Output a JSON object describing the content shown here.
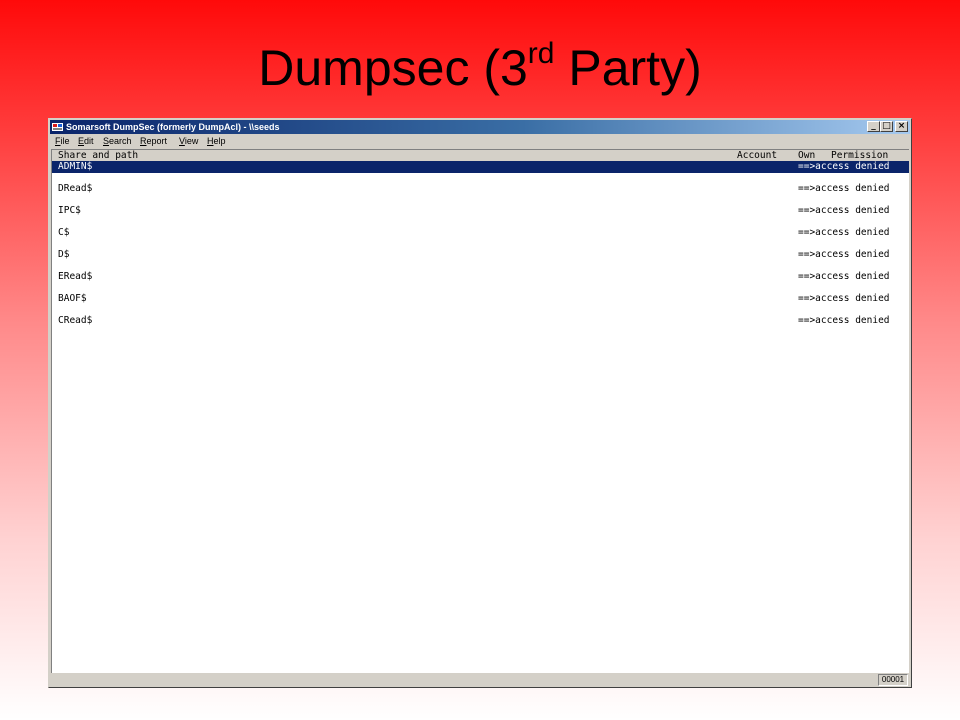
{
  "slide": {
    "title_main": "Dumpsec (3",
    "title_sup": "rd",
    "title_end": " Party)"
  },
  "window": {
    "title": "Somarsoft DumpSec (formerly DumpAcl) - \\\\seeds",
    "buttons": {
      "minimize": "_",
      "maximize": "□",
      "close": "×"
    }
  },
  "menu": {
    "items": [
      {
        "label": "File",
        "accel": "F",
        "rest": "ile"
      },
      {
        "label": "Edit",
        "accel": "E",
        "rest": "dit"
      },
      {
        "label": "Search",
        "accel": "S",
        "rest": "earch"
      },
      {
        "label": "Report",
        "accel": "R",
        "rest": "eport"
      },
      {
        "label": "View",
        "accel": "V",
        "rest": "iew"
      },
      {
        "label": "Help",
        "accel": "H",
        "rest": "elp"
      }
    ]
  },
  "columns": {
    "share_and_path": "Share and path",
    "account": "Account",
    "own": "Own",
    "permission": "Permission"
  },
  "rows": [
    {
      "share": "ADMIN$",
      "permission": "==>access denied",
      "selected": true
    },
    {
      "share": "DRead$",
      "permission": "==>access denied"
    },
    {
      "share": "IPC$",
      "permission": "==>access denied"
    },
    {
      "share": "C$",
      "permission": "==>access denied"
    },
    {
      "share": "D$",
      "permission": "==>access denied"
    },
    {
      "share": "ERead$",
      "permission": "==>access denied"
    },
    {
      "share": "BAOF$",
      "permission": "==>access denied"
    },
    {
      "share": "CRead$",
      "permission": "==>access denied"
    }
  ],
  "status": {
    "count": "00001"
  },
  "colors": {
    "selection": "#0a246a",
    "titlebar_start": "#0a246a",
    "titlebar_end": "#a6caf0",
    "background_top": "#ff0a0a",
    "background_bottom": "#ffffff"
  }
}
